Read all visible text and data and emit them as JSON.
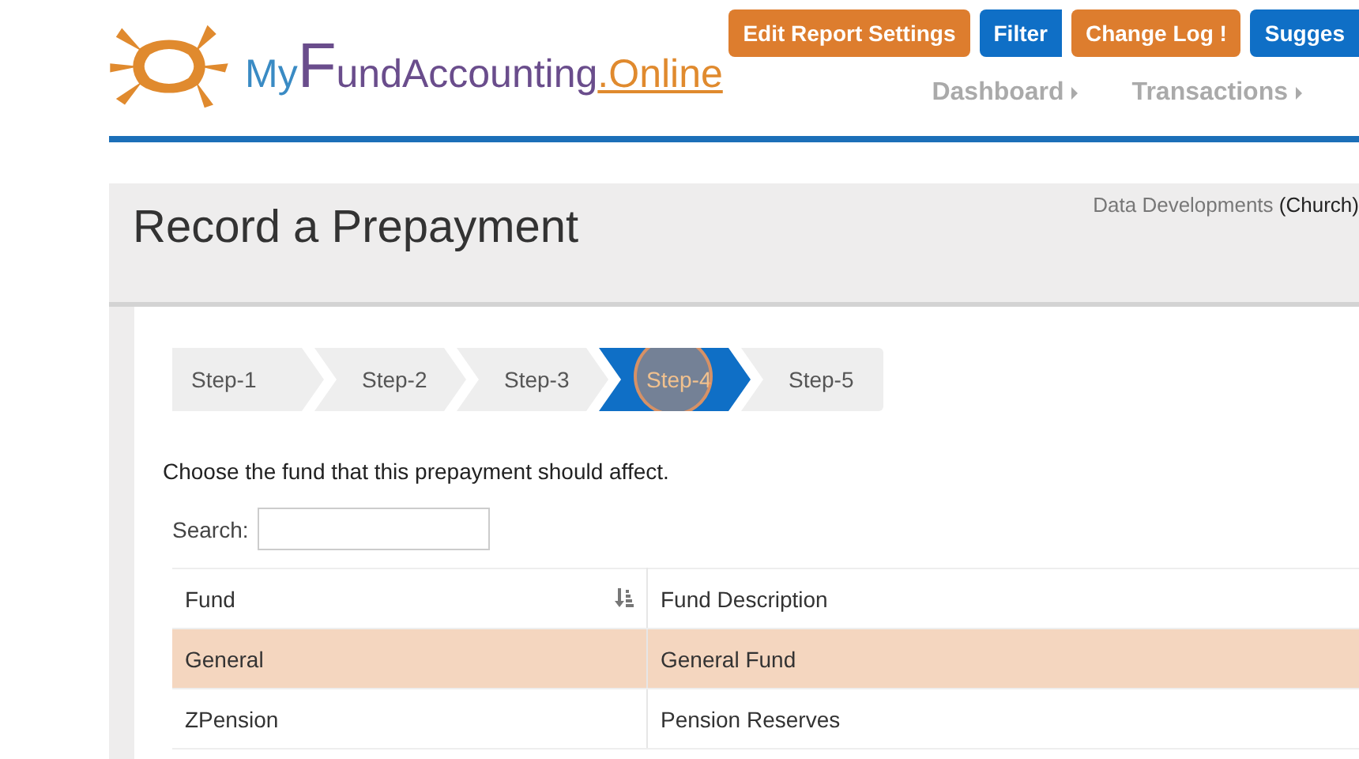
{
  "logo": {
    "parts": [
      {
        "text": "My",
        "kind": "lead"
      },
      {
        "text": "F",
        "kind": "initial"
      },
      {
        "text": "undAccounting",
        "kind": "main"
      },
      {
        "text": ".Online",
        "kind": "accent"
      }
    ]
  },
  "header_buttons": [
    {
      "label": "Edit Report Settings",
      "kind": "orange"
    },
    {
      "label": "Filter",
      "kind": "blue"
    },
    {
      "label": "Change Log !",
      "kind": "orange"
    },
    {
      "label": "Sugges",
      "kind": "blue"
    }
  ],
  "nav": [
    "Dashboard",
    "Transactions"
  ],
  "page": {
    "title": "Record a Prepayment",
    "organization": "Data Developments",
    "org_type": "(Church)"
  },
  "steps": [
    {
      "label": "Step-1",
      "selected": false
    },
    {
      "label": "Step-2",
      "selected": false
    },
    {
      "label": "Step-3",
      "selected": false
    },
    {
      "label": "Step-4",
      "selected": true
    },
    {
      "label": "Step-5",
      "selected": false
    }
  ],
  "instruction": "Choose the fund that this prepayment should affect.",
  "search": {
    "label": "Search:"
  },
  "table": {
    "columns": [
      "Fund",
      "Fund Description"
    ],
    "rows": [
      {
        "cells": [
          "General",
          "General Fund"
        ],
        "selected": true
      },
      {
        "cells": [
          "ZPension",
          "Pension Reserves"
        ],
        "selected": false
      }
    ]
  }
}
